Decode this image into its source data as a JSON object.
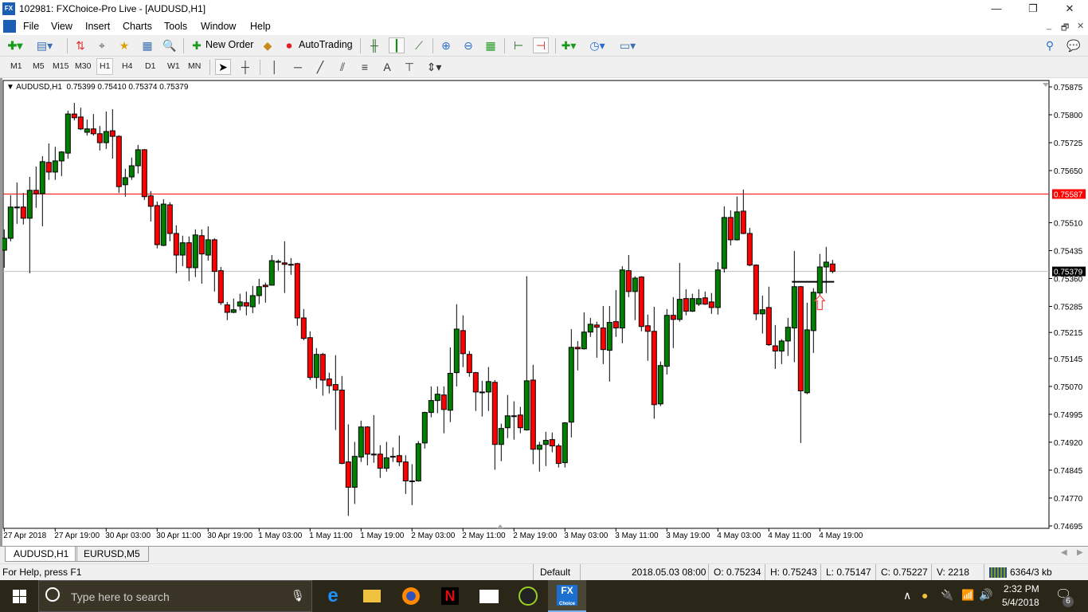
{
  "window": {
    "title": "102981: FXChoice-Pro Live - [AUDUSD,H1]",
    "app_icon": "FX",
    "minimize": "—",
    "maximize": "❐",
    "close": "✕"
  },
  "menu": {
    "items": [
      "File",
      "View",
      "Insert",
      "Charts",
      "Tools",
      "Window",
      "Help"
    ],
    "mdi": [
      "_",
      "🗗",
      "✕"
    ]
  },
  "toolbar": {
    "new_order": "New Order",
    "autotrading": "AutoTrading"
  },
  "timeframes": [
    "M1",
    "M5",
    "M15",
    "M30",
    "H1",
    "H4",
    "D1",
    "W1",
    "MN"
  ],
  "active_timeframe": "H1",
  "drawing_tools": {
    "text_tool": "A"
  },
  "chart_header": {
    "symbol": "AUDUSD,H1",
    "ohlc": "0.75399 0.75410 0.75374 0.75379"
  },
  "chart_data": {
    "type": "candlestick",
    "symbol": "AUDUSD",
    "timeframe": "H1",
    "ylim": [
      0.74695,
      0.75875
    ],
    "y_ticks": [
      "0.75875",
      "0.75800",
      "0.75725",
      "0.75650",
      "0.75510",
      "0.75435",
      "0.75360",
      "0.75285",
      "0.75215",
      "0.75145",
      "0.75070",
      "0.74995",
      "0.74920",
      "0.74845",
      "0.74770",
      "0.74695"
    ],
    "y_tick_values": [
      0.75875,
      0.758,
      0.75725,
      0.7565,
      0.7551,
      0.75435,
      0.7536,
      0.75285,
      0.75215,
      0.75145,
      0.7507,
      0.74995,
      0.7492,
      0.74845,
      0.7477,
      0.74695
    ],
    "x_labels": [
      "27 Apr 2018",
      "27 Apr 19:00",
      "30 Apr 03:00",
      "30 Apr 11:00",
      "30 Apr 19:00",
      "1 May 03:00",
      "1 May 11:00",
      "1 May 19:00",
      "2 May 03:00",
      "2 May 11:00",
      "2 May 19:00",
      "3 May 03:00",
      "3 May 11:00",
      "3 May 19:00",
      "4 May 03:00",
      "4 May 11:00",
      "4 May 19:00"
    ],
    "x_label_every_bars": 8,
    "horizontal_lines": [
      {
        "price": 0.75587,
        "label": "0.75587",
        "color": "#ff0000"
      },
      {
        "price": 0.75379,
        "label": "0.75379",
        "color": "#c0c0c0",
        "bid": true
      },
      {
        "price": 0.75351,
        "color": "#000000",
        "from_bar": 124,
        "to_bar": 130
      }
    ],
    "arrow": {
      "bar": 128,
      "price": 0.75315,
      "type": "up",
      "color": "#ff4040"
    },
    "colors": {
      "bull": "#008000",
      "bear": "#ff0000"
    },
    "ohlc_format": "[open,high,low,close]",
    "candles": [
      [
        0.75436,
        0.75492,
        0.75389,
        0.75468
      ],
      [
        0.75468,
        0.75584,
        0.7546,
        0.75552
      ],
      [
        0.75552,
        0.75618,
        0.75507,
        0.7555
      ],
      [
        0.75552,
        0.7559,
        0.75505,
        0.75522
      ],
      [
        0.75522,
        0.75633,
        0.75374,
        0.75597
      ],
      [
        0.75597,
        0.75661,
        0.7555,
        0.75588
      ],
      [
        0.75588,
        0.75689,
        0.755,
        0.75674
      ],
      [
        0.75672,
        0.75723,
        0.75625,
        0.75646
      ],
      [
        0.75646,
        0.75714,
        0.75625,
        0.75676
      ],
      [
        0.75676,
        0.75702,
        0.75635,
        0.757
      ],
      [
        0.75697,
        0.75811,
        0.75682,
        0.75802
      ],
      [
        0.75802,
        0.75832,
        0.75785,
        0.75792
      ],
      [
        0.75794,
        0.75819,
        0.75759,
        0.75762
      ],
      [
        0.75753,
        0.75787,
        0.75744,
        0.75762
      ],
      [
        0.75762,
        0.75802,
        0.75744,
        0.75749
      ],
      [
        0.75749,
        0.7577,
        0.75704,
        0.75725
      ],
      [
        0.75725,
        0.75809,
        0.75708,
        0.75755
      ],
      [
        0.75757,
        0.75815,
        0.75682,
        0.75742
      ],
      [
        0.75742,
        0.75745,
        0.7559,
        0.75607
      ],
      [
        0.75612,
        0.75655,
        0.7558,
        0.75631
      ],
      [
        0.75633,
        0.75685,
        0.75625,
        0.75663
      ],
      [
        0.75663,
        0.75719,
        0.75642,
        0.75706
      ],
      [
        0.75706,
        0.75708,
        0.75571,
        0.7558
      ],
      [
        0.75582,
        0.75595,
        0.75513,
        0.75554
      ],
      [
        0.75556,
        0.75567,
        0.75441,
        0.75451
      ],
      [
        0.75449,
        0.75573,
        0.75447,
        0.7556
      ],
      [
        0.75558,
        0.75565,
        0.7546,
        0.75481
      ],
      [
        0.75481,
        0.75503,
        0.75374,
        0.75423
      ],
      [
        0.75423,
        0.75475,
        0.75393,
        0.75456
      ],
      [
        0.75456,
        0.75473,
        0.75353,
        0.75389
      ],
      [
        0.75389,
        0.75492,
        0.75364,
        0.75477
      ],
      [
        0.75475,
        0.75492,
        0.75346,
        0.75426
      ],
      [
        0.75423,
        0.755,
        0.75408,
        0.75464
      ],
      [
        0.75464,
        0.75468,
        0.75325,
        0.75379
      ],
      [
        0.75381,
        0.75391,
        0.75289,
        0.75295
      ],
      [
        0.75289,
        0.75297,
        0.75248,
        0.75269
      ],
      [
        0.75269,
        0.75306,
        0.75267,
        0.75276
      ],
      [
        0.75286,
        0.75319,
        0.75274,
        0.75297
      ],
      [
        0.75295,
        0.75325,
        0.75261,
        0.75286
      ],
      [
        0.75284,
        0.7534,
        0.75267,
        0.75314
      ],
      [
        0.75314,
        0.75359,
        0.75291,
        0.75338
      ],
      [
        0.75342,
        0.75349,
        0.75295,
        0.75338
      ],
      [
        0.75342,
        0.75423,
        0.75342,
        0.75408
      ],
      [
        0.75406,
        0.75411,
        0.75381,
        0.75405
      ],
      [
        0.75402,
        0.7546,
        0.75321,
        0.75398
      ],
      [
        0.75398,
        0.75415,
        0.7537,
        0.75397
      ],
      [
        0.754,
        0.75402,
        0.75233,
        0.75254
      ],
      [
        0.75254,
        0.75278,
        0.75194,
        0.75199
      ],
      [
        0.75201,
        0.75218,
        0.75087,
        0.75094
      ],
      [
        0.75094,
        0.75173,
        0.75064,
        0.75156
      ],
      [
        0.75156,
        0.7516,
        0.75045,
        0.75087
      ],
      [
        0.7509,
        0.75107,
        0.75051,
        0.75072
      ],
      [
        0.75075,
        0.75154,
        0.74953,
        0.7506
      ],
      [
        0.7506,
        0.75098,
        0.74861,
        0.74863
      ],
      [
        0.74867,
        0.74968,
        0.74722,
        0.74799
      ],
      [
        0.74799,
        0.74921,
        0.74754,
        0.74882
      ],
      [
        0.7488,
        0.74978,
        0.74867,
        0.74961
      ],
      [
        0.74961,
        0.74963,
        0.74858,
        0.74888
      ],
      [
        0.74888,
        0.74993,
        0.74865,
        0.74887
      ],
      [
        0.74888,
        0.74912,
        0.74824,
        0.7485
      ],
      [
        0.7485,
        0.74921,
        0.74841,
        0.74878
      ],
      [
        0.74882,
        0.74906,
        0.74867,
        0.74881
      ],
      [
        0.74884,
        0.74938,
        0.74856,
        0.74867
      ],
      [
        0.74867,
        0.74885,
        0.74781,
        0.74816
      ],
      [
        0.74816,
        0.74861,
        0.74751,
        0.74815
      ],
      [
        0.74816,
        0.74923,
        0.74814,
        0.74916
      ],
      [
        0.74918,
        0.75002,
        0.74903,
        0.75
      ],
      [
        0.75,
        0.7507,
        0.74987,
        0.75032
      ],
      [
        0.75032,
        0.7507,
        0.74998,
        0.75049
      ],
      [
        0.75047,
        0.7507,
        0.74944,
        0.75008
      ],
      [
        0.75006,
        0.75175,
        0.74974,
        0.75105
      ],
      [
        0.75107,
        0.75291,
        0.7507,
        0.75224
      ],
      [
        0.7522,
        0.75261,
        0.75122,
        0.75158
      ],
      [
        0.75156,
        0.75165,
        0.75096,
        0.75107
      ],
      [
        0.75107,
        0.75109,
        0.75004,
        0.75055
      ],
      [
        0.75055,
        0.75085,
        0.74989,
        0.75054
      ],
      [
        0.75055,
        0.75122,
        0.75004,
        0.75083
      ],
      [
        0.75081,
        0.75087,
        0.74846,
        0.74914
      ],
      [
        0.74914,
        0.7497,
        0.74869,
        0.74957
      ],
      [
        0.74959,
        0.75047,
        0.74931,
        0.74991
      ],
      [
        0.74991,
        0.7503,
        0.74927,
        0.7499
      ],
      [
        0.74993,
        0.75015,
        0.74944,
        0.74959
      ],
      [
        0.74953,
        0.75366,
        0.74951,
        0.75085
      ],
      [
        0.75087,
        0.75128,
        0.74861,
        0.74901
      ],
      [
        0.74901,
        0.74921,
        0.74841,
        0.74912
      ],
      [
        0.74914,
        0.74948,
        0.74856,
        0.74925
      ],
      [
        0.74927,
        0.74946,
        0.74893,
        0.7491
      ],
      [
        0.7491,
        0.74916,
        0.74852,
        0.74863
      ],
      [
        0.74865,
        0.74974,
        0.74852,
        0.74972
      ],
      [
        0.74974,
        0.75224,
        0.74933,
        0.75175
      ],
      [
        0.75175,
        0.75192,
        0.75113,
        0.75171
      ],
      [
        0.75171,
        0.75269,
        0.75169,
        0.75216
      ],
      [
        0.75216,
        0.75254,
        0.75203,
        0.75237
      ],
      [
        0.75235,
        0.75244,
        0.75147,
        0.75229
      ],
      [
        0.75227,
        0.75286,
        0.7513,
        0.75169
      ],
      [
        0.75167,
        0.75286,
        0.75083,
        0.75242
      ],
      [
        0.75244,
        0.75329,
        0.75203,
        0.75227
      ],
      [
        0.75227,
        0.75393,
        0.75186,
        0.75383
      ],
      [
        0.75381,
        0.75423,
        0.7531,
        0.75325
      ],
      [
        0.75325,
        0.75366,
        0.75248,
        0.75361
      ],
      [
        0.75364,
        0.75366,
        0.75218,
        0.75231
      ],
      [
        0.75233,
        0.75263,
        0.75139,
        0.75218
      ],
      [
        0.75218,
        0.75284,
        0.74983,
        0.75021
      ],
      [
        0.75023,
        0.75137,
        0.75017,
        0.75126
      ],
      [
        0.75124,
        0.75278,
        0.75102,
        0.75261
      ],
      [
        0.75261,
        0.7531,
        0.75173,
        0.7525
      ],
      [
        0.7525,
        0.75402,
        0.75244,
        0.75304
      ],
      [
        0.75306,
        0.75331,
        0.75261,
        0.75272
      ],
      [
        0.75272,
        0.75319,
        0.7527,
        0.75306
      ],
      [
        0.75291,
        0.75331,
        0.75286,
        0.75306
      ],
      [
        0.75308,
        0.75325,
        0.75289,
        0.75291
      ],
      [
        0.75297,
        0.75321,
        0.75265,
        0.75282
      ],
      [
        0.75282,
        0.75404,
        0.75263,
        0.75383
      ],
      [
        0.75387,
        0.75554,
        0.75376,
        0.75524
      ],
      [
        0.75524,
        0.75543,
        0.75449,
        0.75464
      ],
      [
        0.75464,
        0.7558,
        0.75462,
        0.75539
      ],
      [
        0.75541,
        0.75599,
        0.75479,
        0.75481
      ],
      [
        0.75481,
        0.75496,
        0.75393,
        0.75396
      ],
      [
        0.75396,
        0.75398,
        0.75248,
        0.75265
      ],
      [
        0.75265,
        0.75314,
        0.75212,
        0.75276
      ],
      [
        0.75282,
        0.75338,
        0.75179,
        0.75182
      ],
      [
        0.75179,
        0.75235,
        0.75117,
        0.75165
      ],
      [
        0.75165,
        0.75197,
        0.7513,
        0.75192
      ],
      [
        0.75192,
        0.75254,
        0.75152,
        0.75229
      ],
      [
        0.75227,
        0.75434,
        0.75135,
        0.75338
      ],
      [
        0.75338,
        0.7534,
        0.74918,
        0.75058
      ],
      [
        0.75053,
        0.75295,
        0.75049,
        0.75222
      ],
      [
        0.7522,
        0.75334,
        0.7516,
        0.75323
      ],
      [
        0.75321,
        0.75426,
        0.75291,
        0.75391
      ],
      [
        0.75391,
        0.75445,
        0.75321,
        0.75404
      ],
      [
        0.75399,
        0.7541,
        0.75374,
        0.75379
      ]
    ]
  },
  "chart_tabs": [
    {
      "label": "AUDUSD,H1",
      "active": true
    },
    {
      "label": "EURUSD,M5",
      "active": false
    }
  ],
  "status": {
    "help": "For Help, press F1",
    "profile": "Default",
    "datetime": "2018.05.03 08:00",
    "open": "O: 0.75234",
    "high": "H: 0.75243",
    "low": "L: 0.75147",
    "close": "C: 0.75227",
    "volume": "V: 2218",
    "traffic": "6364/3 kb"
  },
  "taskbar": {
    "search_placeholder": "Type here to search",
    "time": "2:32 PM",
    "date": "5/4/2018",
    "notifications": "6",
    "fx_label": "FX",
    "fx_sub": "Choice"
  }
}
